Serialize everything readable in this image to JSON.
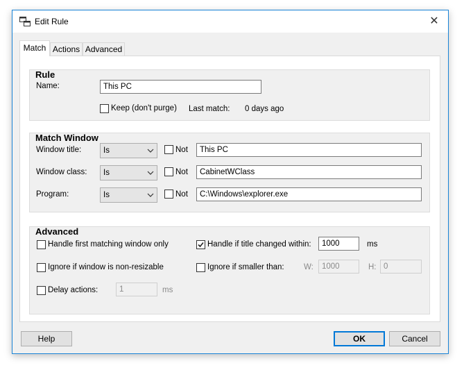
{
  "window": {
    "title": "Edit Rule",
    "close_glyph": "✕"
  },
  "tabs": [
    {
      "label": "Match"
    },
    {
      "label": "Actions"
    },
    {
      "label": "Advanced"
    }
  ],
  "rule": {
    "title": "Rule",
    "name_label": "Name:",
    "name_value": "This PC",
    "keep_label": "Keep (don't purge)",
    "keep_checked": false,
    "last_match_label": "Last match:",
    "last_match_value": "0 days ago"
  },
  "match_window": {
    "title": "Match Window",
    "rows": [
      {
        "label": "Window title:",
        "op": "Is",
        "not_label": "Not",
        "not_checked": false,
        "value": "This PC"
      },
      {
        "label": "Window class:",
        "op": "Is",
        "not_label": "Not",
        "not_checked": false,
        "value": "CabinetWClass"
      },
      {
        "label": "Program:",
        "op": "Is",
        "not_label": "Not",
        "not_checked": false,
        "value": "C:\\Windows\\explorer.exe"
      }
    ]
  },
  "advanced": {
    "title": "Advanced",
    "first_match_label": "Handle first matching window only",
    "first_match_checked": false,
    "title_changed_label": "Handle if title changed within:",
    "title_changed_checked": true,
    "title_changed_value": "1000",
    "title_changed_unit": "ms",
    "non_resizable_label": "Ignore if window is non-resizable",
    "non_resizable_checked": false,
    "smaller_label": "Ignore if smaller than:",
    "smaller_checked": false,
    "w_label": "W:",
    "w_value": "1000",
    "h_label": "H:",
    "h_value": "0",
    "delay_label": "Delay actions:",
    "delay_checked": false,
    "delay_value": "1",
    "delay_unit": "ms"
  },
  "buttons": {
    "help": "Help",
    "ok": "OK",
    "cancel": "Cancel"
  },
  "colors": {
    "accent": "#0078d7",
    "window_border": "#1883d7",
    "dialog_bg": "#f0f0f0"
  }
}
